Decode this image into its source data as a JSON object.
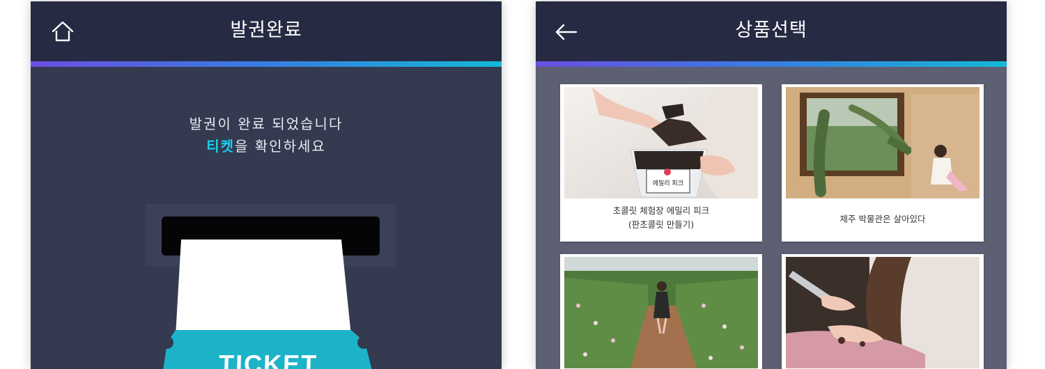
{
  "colors": {
    "header_bg": "#262a42",
    "screen_left_bg": "#343a4f",
    "screen_right_bg": "#5d6073",
    "accent_start": "#6a4fe0",
    "accent_mid": "#3a7be0",
    "accent_end": "#14b8d6",
    "highlight": "#19d2f0",
    "ticket": "#1cb3c9"
  },
  "left_screen": {
    "header": {
      "title": "발권완료",
      "left_icon": "home-icon"
    },
    "message": {
      "line1": "발권이 완료 되었습니다",
      "line2_highlight": "티켓",
      "line2_rest": "을 확인하세요"
    },
    "ticket": {
      "label": "TICKET"
    }
  },
  "right_screen": {
    "header": {
      "title": "상품선택",
      "left_icon": "back-arrow-icon"
    },
    "products": [
      {
        "caption_line1": "초콜릿 체험장 에밀리 피크",
        "caption_line2": "(판초콜릿 만들기)",
        "cup_label": "에밀리 피크"
      },
      {
        "caption_line1": "제주 박물관은 살아있다",
        "caption_line2": ""
      },
      {
        "caption_line1": "",
        "caption_line2": ""
      },
      {
        "caption_line1": "",
        "caption_line2": ""
      }
    ]
  }
}
